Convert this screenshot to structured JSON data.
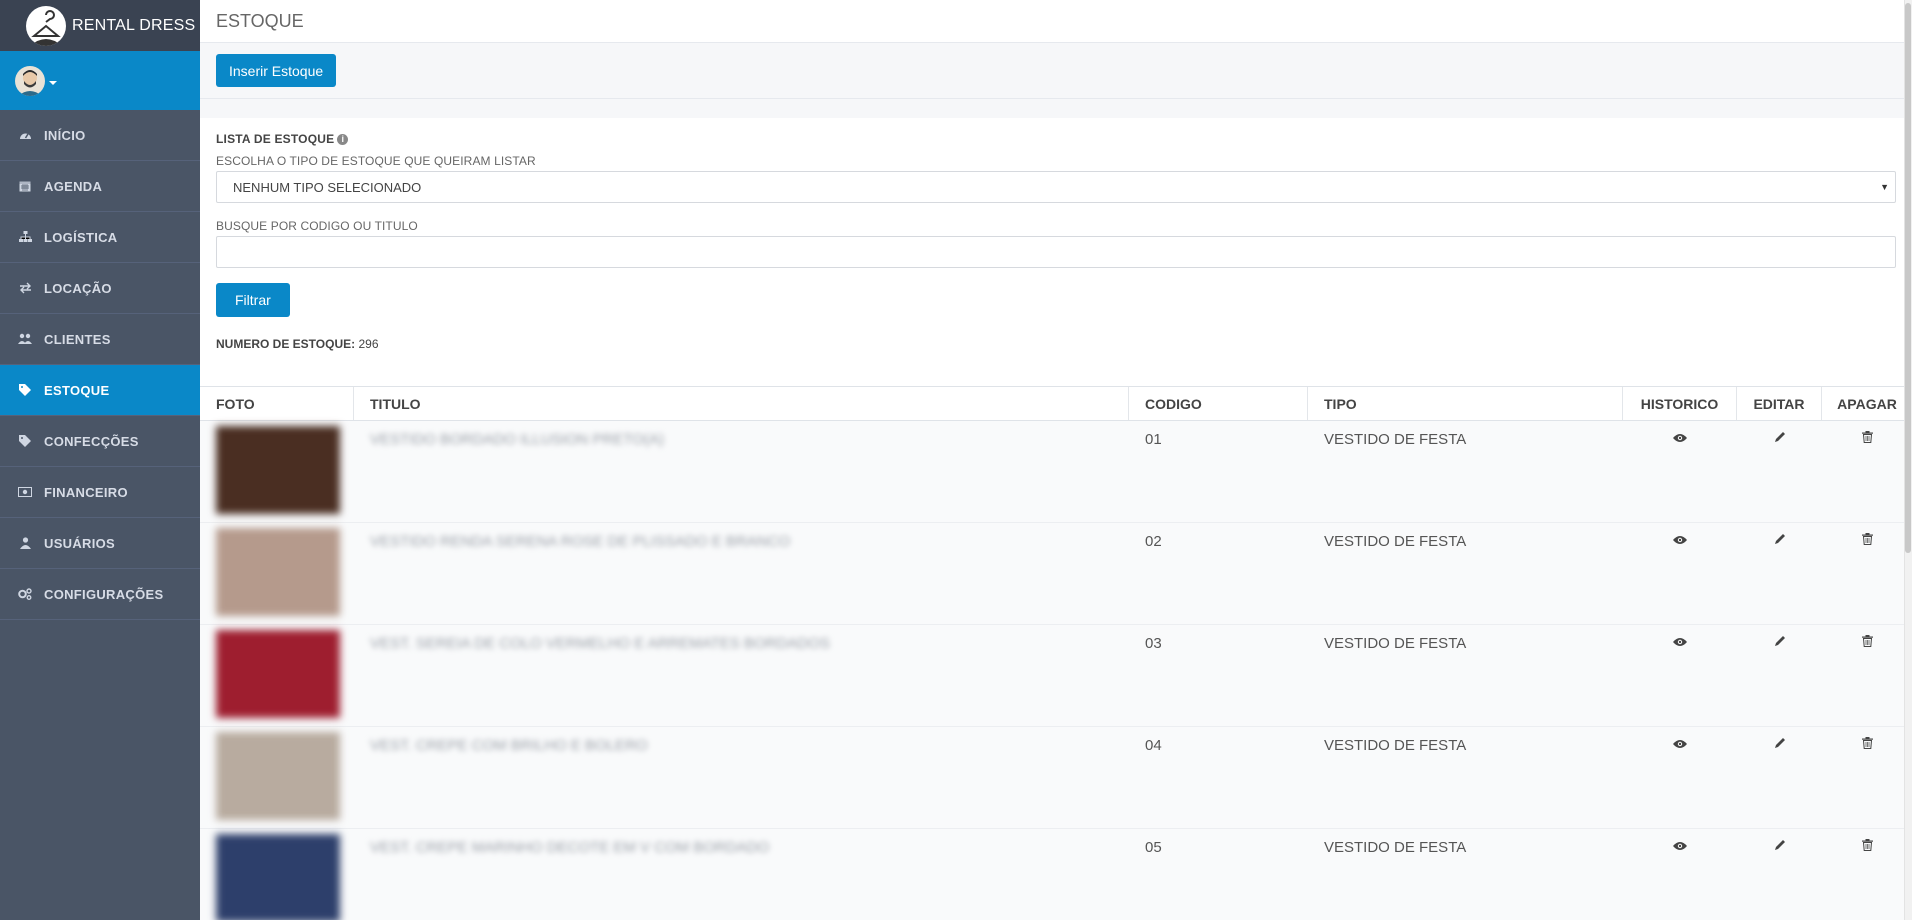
{
  "brand": {
    "name": "RENTAL DRESS"
  },
  "sidebar": {
    "items": [
      {
        "label": "INÍCIO",
        "icon": "dashboard-icon"
      },
      {
        "label": "AGENDA",
        "icon": "calendar-icon"
      },
      {
        "label": "LOGÍSTICA",
        "icon": "sitemap-icon"
      },
      {
        "label": "LOCAÇÃO",
        "icon": "exchange-icon"
      },
      {
        "label": "CLIENTES",
        "icon": "users-icon"
      },
      {
        "label": "ESTOQUE",
        "icon": "tag-icon",
        "active": true
      },
      {
        "label": "CONFECÇÕES",
        "icon": "tag-icon"
      },
      {
        "label": "FINANCEIRO",
        "icon": "money-icon"
      },
      {
        "label": "USUÁRIOS",
        "icon": "user-icon"
      },
      {
        "label": "CONFIGURAÇÕES",
        "icon": "cogs-icon"
      }
    ]
  },
  "header": {
    "title": "ESTOQUE"
  },
  "toolbar": {
    "insert_label": "Inserir Estoque"
  },
  "filter": {
    "section_title": "LISTA DE ESTOQUE",
    "type_label": "ESCOLHA O TIPO DE ESTOQUE QUE QUEIRAM LISTAR",
    "type_selected": "NENHUM TIPO SELECIONADO",
    "search_label": "BUSQUE POR CODIGO OU TITULO",
    "search_value": "",
    "filter_button": "Filtrar",
    "count_label": "NUMERO DE ESTOQUE:",
    "count_value": "296"
  },
  "table": {
    "headers": [
      "FOTO",
      "TITULO",
      "CODIGO",
      "TIPO",
      "HISTORICO",
      "EDITAR",
      "APAGAR"
    ],
    "rows": [
      {
        "codigo": "01",
        "tipo": "VESTIDO DE FESTA",
        "titulo_blurred": "VESTIDO BORDADO ILLUSION PRETO(A)",
        "thumb_color": "#4a2e22"
      },
      {
        "codigo": "02",
        "tipo": "VESTIDO DE FESTA",
        "titulo_blurred": "VESTIDO RENDA SERENA ROSE DE PLISSADO E BRANCO",
        "thumb_color": "#b59a8c"
      },
      {
        "codigo": "03",
        "tipo": "VESTIDO DE FESTA",
        "titulo_blurred": "VEST. SEREIA DE COLO VERMELHO E ARREMATES BORDADOS",
        "thumb_color": "#9e1e2f"
      },
      {
        "codigo": "04",
        "tipo": "VESTIDO DE FESTA",
        "titulo_blurred": "VEST. CREPE COM BRILHO E BOLERO",
        "thumb_color": "#b8ab9f"
      },
      {
        "codigo": "05",
        "tipo": "VESTIDO DE FESTA",
        "titulo_blurred": "VEST. CREPE MARINHO DECOTE EM V COM BORDADO",
        "thumb_color": "#2d3f6b"
      }
    ]
  },
  "colors": {
    "accent": "#0a88c8",
    "sidebar": "#4a5566"
  }
}
